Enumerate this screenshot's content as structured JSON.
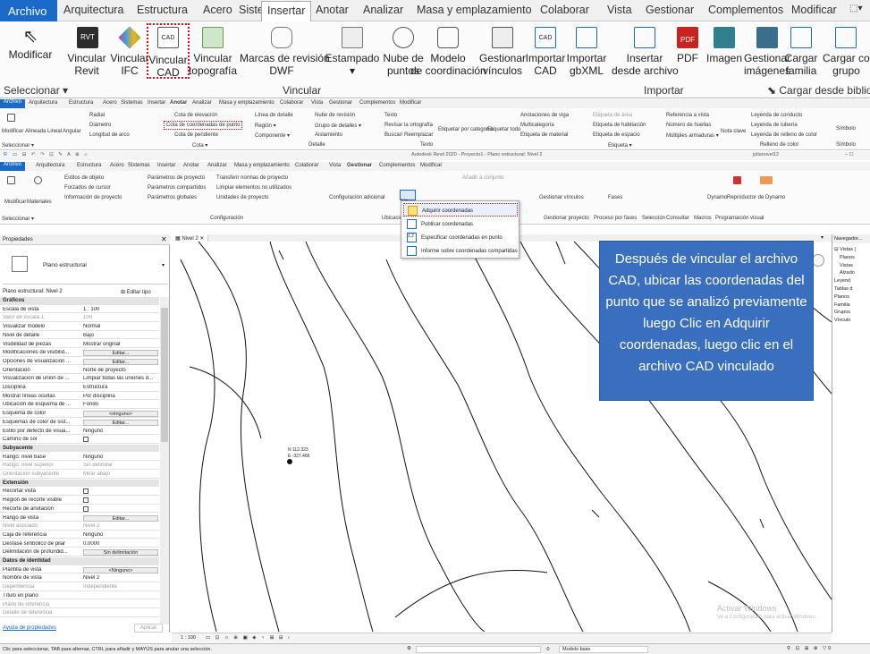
{
  "ribbon_tabs": [
    "Archivo",
    "Arquitectura",
    "Estructura",
    "Acero",
    "Sistemas",
    "Insertar",
    "Anotar",
    "Analizar",
    "Masa y emplazamiento",
    "Colaborar",
    "Vista",
    "Gestionar",
    "Complementos",
    "Modificar"
  ],
  "ribbon_buttons": {
    "modificar": "Modificar",
    "vincular_revit": [
      "Vincular",
      "Revit"
    ],
    "vincular_ifc": [
      "Vincular",
      "IFC"
    ],
    "vincular_cad": [
      "Vincular",
      "CAD"
    ],
    "vincular_topo": [
      "Vincular",
      "topografía"
    ],
    "marcas_dwf": [
      "Marcas de revisión",
      "DWF"
    ],
    "estampado": "Estampado",
    "nube_puntos": [
      "Nube de",
      "puntos"
    ],
    "modelo_coord": [
      "Modelo",
      "de coordinación"
    ],
    "gestionar_vinculos": [
      "Gestionar",
      "vínculos"
    ],
    "importar_cad": [
      "Importar",
      "CAD"
    ],
    "importar_gbxml": [
      "Importar",
      "gbXML"
    ],
    "insertar_archivo": [
      "Insertar",
      "desde archivo"
    ],
    "pdf": "PDF",
    "imagen": "Imagen",
    "gestionar_imagenes": [
      "Gestionar",
      "imágenes"
    ],
    "cargar_familia": [
      "Cargar",
      "familia"
    ],
    "cargar_grupo": [
      "Cargar como",
      "grupo"
    ]
  },
  "ribbon_groups": {
    "seleccionar": "Seleccionar ▾",
    "vincular": "Vincular",
    "importar": "Importar",
    "cargar": "Cargar desde biblioteca"
  },
  "anotar_ribbon": {
    "tabs": [
      "Archivo",
      "Arquitectura",
      "Estructura",
      "Acero",
      "Sistemas",
      "Insertar",
      "Anotar",
      "Analizar",
      "Masa y emplazamiento",
      "Colaborar",
      "Vista",
      "Gestionar",
      "Complementos",
      "Modificar"
    ],
    "items": [
      "Modificar",
      "Alineada",
      "Lineal",
      "Angular",
      "Radial",
      "Diámetro",
      "Longitud de arco",
      "Cota de elevación",
      "Cota de coordenadas de punto",
      "Cota de pendiente",
      "Línea de detalle",
      "Región ▾",
      "Componente ▾",
      "Nube de revisión",
      "Grupo de detalles ▾",
      "Aislamiento",
      "Texto",
      "Revisar la ortografía",
      "Buscar/ Reemplazar",
      "Etiquetar por categoría",
      "Etiquetar todo",
      "Anotaciones de viga",
      "Multicategoría",
      "Etiqueta de material",
      "Etiqueta de área",
      "Etiqueta de habitación",
      "Etiqueta de espacio",
      "Referencia a vista",
      "Número de huellas",
      "Múltiples armaduras ▾",
      "Nota clave",
      "Leyenda de conducto",
      "Leyenda de tubería",
      "Leyenda de relleno de color",
      "Símbolo"
    ],
    "groups": [
      "Seleccionar ▾",
      "Cota ▾",
      "Detalle",
      "Texto",
      "Etiqueta ▾",
      "Relleno de color",
      "Símbolo"
    ]
  },
  "quick_access_title": "Autodesk Revit 2020 - Proyecto1 - Plano estructural: Nivel 2",
  "user": "julianovel12",
  "gestionar_ribbon": {
    "tabs": [
      "Archivo",
      "Arquitectura",
      "Estructura",
      "Acero",
      "Sistemas",
      "Insertar",
      "Anotar",
      "Analizar",
      "Masa y emplazamiento",
      "Colaborar",
      "Vista",
      "Gestionar",
      "Complementos",
      "Modificar"
    ],
    "items": [
      "Modificar",
      "Materiales",
      "Estilos de objeto",
      "Forzados de cursor",
      "Información de proyecto",
      "Parámetros de proyecto",
      "Parámetros compartidos",
      "Parámetros globales",
      "Transferir normas de proyecto",
      "Limpiar elementos no utilizados",
      "Unidades de proyecto",
      "Configuración adicional",
      "Añadir a conjunto",
      "Gestionar vínculos",
      "Fases",
      "Dynamo",
      "Reproductor de Dynamo"
    ],
    "groups": [
      "Seleccionar ▾",
      "Configuración",
      "Ubicación",
      "Gestionar proyecto",
      "Proceso por fases",
      "Selección",
      "Consultar",
      "Macros",
      "Programación visual"
    ]
  },
  "dropdown": [
    "Adquirir coordenadas",
    "Publicar coordenadas",
    "Especificar coordenadas en punto",
    "Informe sobre coordenadas compartidas"
  ],
  "properties": {
    "title": "Propiedades",
    "type": "Plano estructural",
    "instance": "Plano estructural: Nivel 2",
    "edit_type": "Editar tipo",
    "rows": [
      {
        "s": "Gráficos"
      },
      {
        "k": "Escala de vista",
        "v": "1 : 100"
      },
      {
        "k": "Valor de escala   1:",
        "v": "100",
        "g": true
      },
      {
        "k": "Visualizar modelo",
        "v": "Normal"
      },
      {
        "k": "Nivel de detalle",
        "v": "Bajo"
      },
      {
        "k": "Visibilidad de piezas",
        "v": "Mostrar original"
      },
      {
        "k": "Modificaciones de visibilid...",
        "b": "Editar..."
      },
      {
        "k": "Opciones de visualización ...",
        "b": "Editar..."
      },
      {
        "k": "Orientación",
        "v": "Norte de proyecto"
      },
      {
        "k": "Visualización de unión de ...",
        "v": "Limpiar todas las uniones d..."
      },
      {
        "k": "Disciplina",
        "v": "Estructura"
      },
      {
        "k": "Mostrar líneas ocultas",
        "v": "Por disciplina"
      },
      {
        "k": "Ubicación de esquema de ...",
        "v": "Fondo"
      },
      {
        "k": "Esquema de color",
        "b": "<ninguno>"
      },
      {
        "k": "Esquemas de color de sist...",
        "b": "Editar..."
      },
      {
        "k": "Estilo por defecto de visua...",
        "v": "Ninguno"
      },
      {
        "k": "Camino de sol",
        "c": true
      },
      {
        "s": "Subyacente"
      },
      {
        "k": "Rango: nivel base",
        "v": "Ninguno"
      },
      {
        "k": "Rango: nivel superior",
        "v": "Sin delimitar",
        "g": true
      },
      {
        "k": "Orientación subyacente",
        "v": "Mirar abajo",
        "g": true
      },
      {
        "s": "Extensión"
      },
      {
        "k": "Recortar vista",
        "c": true
      },
      {
        "k": "Región de recorte visible",
        "c": true
      },
      {
        "k": "Recorte de anotación",
        "c": true
      },
      {
        "k": "Rango de vista",
        "b": "Editar..."
      },
      {
        "k": "Nivel asociado",
        "v": "Nivel 2",
        "g": true
      },
      {
        "k": "Caja de referencia",
        "v": "Ninguno"
      },
      {
        "k": "Desfase simbólico de pilar",
        "v": "0.0000"
      },
      {
        "k": "Delimitación de profundid...",
        "b": "Sin delimitación"
      },
      {
        "s": "Datos de identidad"
      },
      {
        "k": "Plantilla de vista",
        "b": "<Ninguno>"
      },
      {
        "k": "Nombre de vista",
        "v": "Nivel 2"
      },
      {
        "k": "Dependencia",
        "v": "Independiente",
        "g": true
      },
      {
        "k": "Título en plano",
        "v": ""
      },
      {
        "k": "Plano de referencia",
        "v": "",
        "g": true
      },
      {
        "k": "Detalle de referencia",
        "v": "",
        "g": true
      }
    ],
    "help": "Ayuda de propiedades",
    "apply": "Aplicar"
  },
  "view_tab": "Nivel 2",
  "coords": [
    "N 112.323",
    "E -327.466"
  ],
  "callout": "Después de vincular el archivo CAD, ubicar las coordenadas del punto que se analizó previamente luego Clic en Adquirir coordenadas, luego clic en el archivo CAD vinculado",
  "navigator": {
    "title": "Navegador...",
    "items": [
      "Vistas (",
      "Planos",
      "Vistas",
      "Alzado",
      "Leyend",
      "Tablas d",
      "Planos",
      "Familia",
      "Grupos",
      "Vínculo"
    ]
  },
  "scale": "1 : 100",
  "status": "Clic para seleccionar, TAB para alternar, CTRL para añadir y MAYÚS para anular una selección.",
  "status_model": "Modelo base",
  "status_zero": ":0",
  "watermark": [
    "Activar Windows",
    "Ve a Configuración para activar Windows."
  ]
}
